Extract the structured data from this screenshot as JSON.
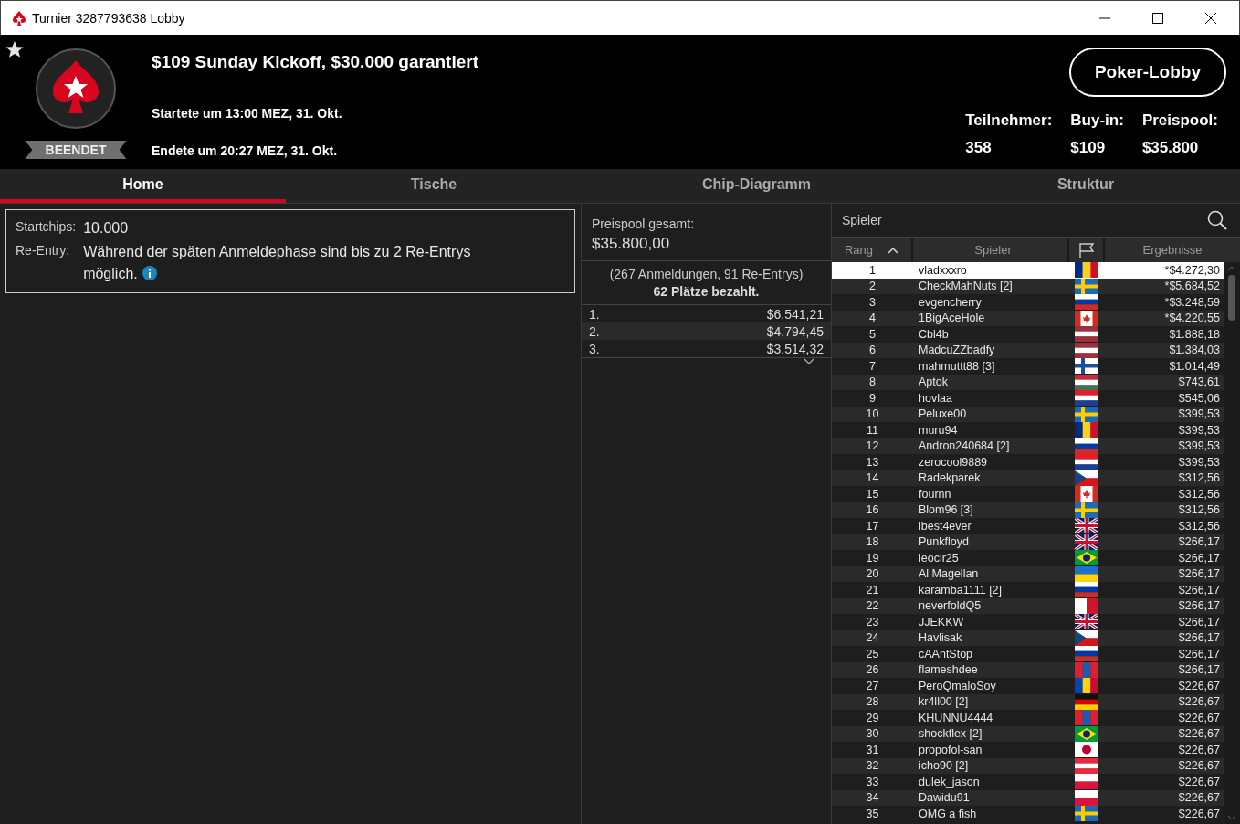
{
  "window": {
    "title": "Turnier 3287793638 Lobby"
  },
  "header": {
    "favorite": false,
    "status": "BEENDET",
    "title": "$109 Sunday Kickoff, $30.000 garantiert",
    "started": "Startete um 13:00 MEZ, 31. Okt.",
    "ended": "Endete um 20:27 MEZ, 31. Okt.",
    "lobby_button": "Poker-Lobby",
    "stats": [
      {
        "label": "Teilnehmer:",
        "value": "358"
      },
      {
        "label": "Buy-in:",
        "value": "$109"
      },
      {
        "label": "Preispool:",
        "value": "$35.800"
      }
    ]
  },
  "tabs": [
    {
      "label": "Home",
      "selected": true
    },
    {
      "label": "Tische",
      "selected": false
    },
    {
      "label": "Chip-Diagramm",
      "selected": false
    },
    {
      "label": "Struktur",
      "selected": false
    }
  ],
  "info": [
    {
      "label": "Startchips:",
      "value": "10.000",
      "info_icon": false
    },
    {
      "label": "Re-Entry:",
      "value": "Während der späten Anmeldephase sind bis zu 2 Re-Entrys möglich.",
      "info_icon": true
    }
  ],
  "prizes": {
    "label": "Preispool gesamt:",
    "total": "$35.800,00",
    "entries": "(267 Anmeldungen, 91 Re-Entrys)",
    "paid": "62 Plätze bezahlt.",
    "places": [
      {
        "place": "1.",
        "amount": "$6.541,21"
      },
      {
        "place": "2.",
        "amount": "$4.794,45"
      },
      {
        "place": "3.",
        "amount": "$3.514,32"
      }
    ]
  },
  "players": {
    "title": "Spieler",
    "columns": [
      "Rang",
      "Spieler",
      "Ergebnisse"
    ],
    "rows": [
      {
        "rank": "1",
        "name": "vladxxxro",
        "kind": "ro",
        "result": "*$4.272,30",
        "selected": true
      },
      {
        "rank": "2",
        "name": "CheckMahNuts [2]",
        "kind": "se",
        "result": "*$5.684,52",
        "selected": false
      },
      {
        "rank": "3",
        "name": "evgencherry",
        "kind": "ru",
        "result": "*$3.248,59",
        "selected": false
      },
      {
        "rank": "4",
        "name": "1BigAceHole",
        "kind": "ca",
        "result": "*$4.220,55",
        "selected": false
      },
      {
        "rank": "5",
        "name": "Cbl4b",
        "kind": "lv",
        "result": "$1.888,18",
        "selected": false
      },
      {
        "rank": "6",
        "name": "MadcuZZbadfy",
        "kind": "lv",
        "result": "$1.384,03",
        "selected": false
      },
      {
        "rank": "7",
        "name": "mahmuttt88 [3]",
        "kind": "fi",
        "result": "$1.014,49",
        "selected": false
      },
      {
        "rank": "8",
        "name": "Aptok",
        "kind": "hu",
        "result": "$743,61",
        "selected": false
      },
      {
        "rank": "9",
        "name": "hovlaa",
        "kind": "hr",
        "result": "$545,06",
        "selected": false
      },
      {
        "rank": "10",
        "name": "Peluxe00",
        "kind": "se",
        "result": "$399,53",
        "selected": false
      },
      {
        "rank": "11",
        "name": "muru94",
        "kind": "ro",
        "result": "$399,53",
        "selected": false
      },
      {
        "rank": "12",
        "name": "Andron240684 [2]",
        "kind": "ru",
        "result": "$399,53",
        "selected": false
      },
      {
        "rank": "13",
        "name": "zerocool9889",
        "kind": "hr",
        "result": "$399,53",
        "selected": false
      },
      {
        "rank": "14",
        "name": "Radekparek",
        "kind": "cz",
        "result": "$312,56",
        "selected": false
      },
      {
        "rank": "15",
        "name": "fournn",
        "kind": "ca",
        "result": "$312,56",
        "selected": false
      },
      {
        "rank": "16",
        "name": "Blom96 [3]",
        "kind": "se",
        "result": "$312,56",
        "selected": false
      },
      {
        "rank": "17",
        "name": "ibest4ever",
        "kind": "gb",
        "result": "$312,56",
        "selected": false
      },
      {
        "rank": "18",
        "name": "Punkfloyd",
        "kind": "gb",
        "result": "$266,17",
        "selected": false
      },
      {
        "rank": "19",
        "name": "leocir25",
        "kind": "br",
        "result": "$266,17",
        "selected": false
      },
      {
        "rank": "20",
        "name": "Al Magellan",
        "kind": "ua",
        "result": "$266,17",
        "selected": false
      },
      {
        "rank": "21",
        "name": "karamba1111 [2]",
        "kind": "ru",
        "result": "$266,17",
        "selected": false
      },
      {
        "rank": "22",
        "name": "neverfoldQ5",
        "kind": "mt",
        "result": "$266,17",
        "selected": false
      },
      {
        "rank": "23",
        "name": "JJEKKW",
        "kind": "gb",
        "result": "$266,17",
        "selected": false
      },
      {
        "rank": "24",
        "name": "Havlisak",
        "kind": "cz",
        "result": "$266,17",
        "selected": false
      },
      {
        "rank": "25",
        "name": "cAAntStop",
        "kind": "ru",
        "result": "$266,17",
        "selected": false
      },
      {
        "rank": "26",
        "name": "flameshdee",
        "kind": "mn",
        "result": "$266,17",
        "selected": false
      },
      {
        "rank": "27",
        "name": "PeroQmaloSoy",
        "kind": "md",
        "result": "$226,67",
        "selected": false
      },
      {
        "rank": "28",
        "name": "kr4ll00 [2]",
        "kind": "de",
        "result": "$226,67",
        "selected": false
      },
      {
        "rank": "29",
        "name": "KHUNNU4444",
        "kind": "mn",
        "result": "$226,67",
        "selected": false
      },
      {
        "rank": "30",
        "name": "shockflex [2]",
        "kind": "br",
        "result": "$226,67",
        "selected": false
      },
      {
        "rank": "31",
        "name": "propofol-san",
        "kind": "jp",
        "result": "$226,67",
        "selected": false
      },
      {
        "rank": "32",
        "name": "icho90 [2]",
        "kind": "at",
        "result": "$226,67",
        "selected": false
      },
      {
        "rank": "33",
        "name": "dulek_jason",
        "kind": "pl",
        "result": "$226,67",
        "selected": false
      },
      {
        "rank": "34",
        "name": "Dawidu91",
        "kind": "pl",
        "result": "$226,67",
        "selected": false
      },
      {
        "rank": "35",
        "name": "OMG a fish",
        "kind": "se",
        "result": "$226,67",
        "selected": false
      }
    ]
  }
}
